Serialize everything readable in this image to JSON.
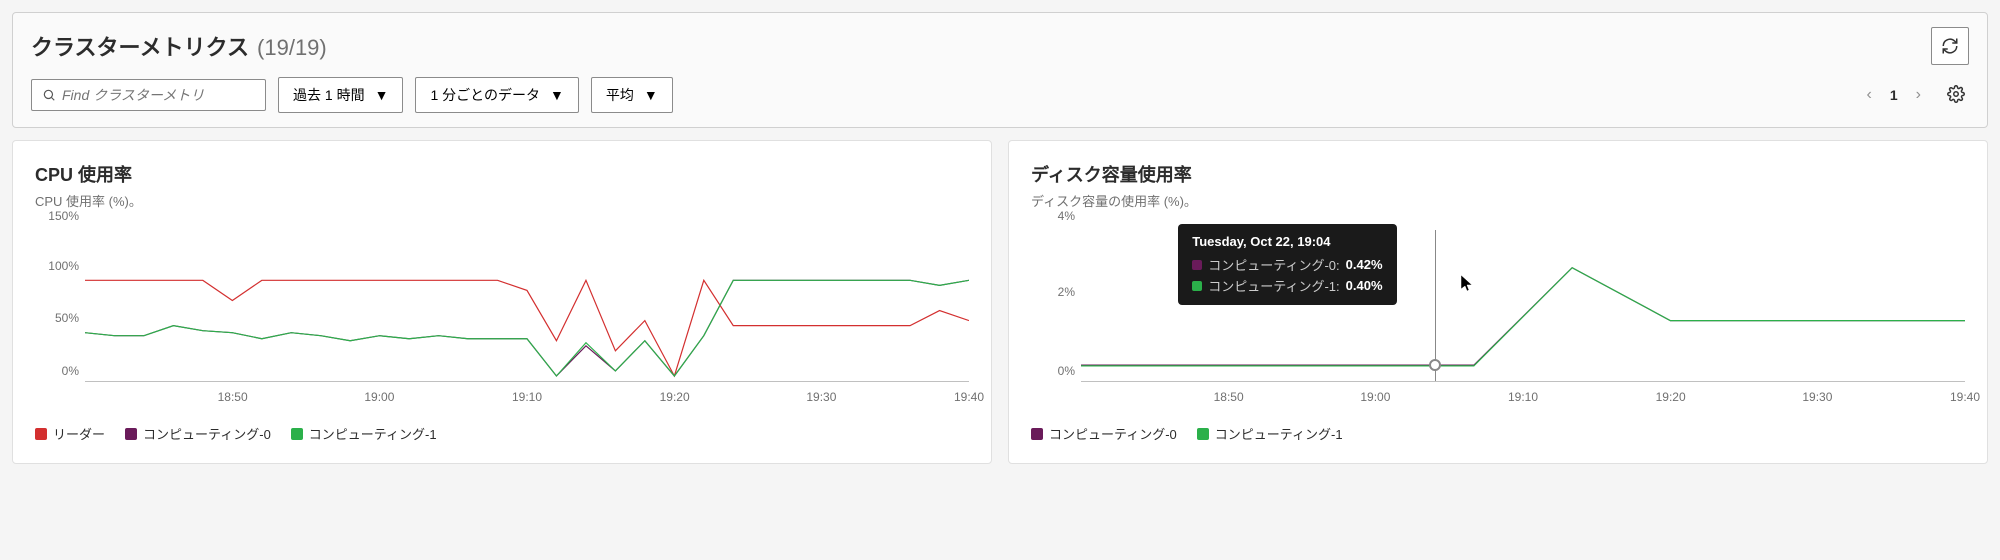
{
  "header": {
    "title": "クラスターメトリクス",
    "count": "(19/19)",
    "search_placeholder": "Find クラスターメトリ",
    "time_range": "過去 1 時間",
    "granularity": "1 分ごとのデータ",
    "aggregation": "平均",
    "page_num": "1"
  },
  "charts": {
    "cpu": {
      "title": "CPU 使用率",
      "subtitle": "CPU 使用率 (%)。",
      "y_ticks": [
        "0%",
        "50%",
        "100%",
        "150%"
      ],
      "x_ticks": [
        "18:50",
        "19:00",
        "19:10",
        "19:20",
        "19:30",
        "19:40"
      ],
      "legend": [
        {
          "label": "リーダー",
          "color": "#d32f2f"
        },
        {
          "label": "コンピューティング-0",
          "color": "#6a1b5a"
        },
        {
          "label": "コンピューティング-1",
          "color": "#2bb04a"
        }
      ]
    },
    "disk": {
      "title": "ディスク容量使用率",
      "subtitle": "ディスク容量の使用率 (%)。",
      "y_ticks": [
        "0%",
        "2%",
        "4%"
      ],
      "x_ticks": [
        "18:50",
        "19:00",
        "19:10",
        "19:20",
        "19:30",
        "19:40"
      ],
      "legend": [
        {
          "label": "コンピューティング-0",
          "color": "#6a1b5a"
        },
        {
          "label": "コンピューティング-1",
          "color": "#2bb04a"
        }
      ],
      "tooltip": {
        "title": "Tuesday, Oct 22, 19:04",
        "rows": [
          {
            "label": "コンピューティング-0:",
            "value": "0.42%",
            "color": "#6a1b5a"
          },
          {
            "label": "コンピューティング-1:",
            "value": "0.40%",
            "color": "#2bb04a"
          }
        ]
      }
    }
  },
  "chart_data": [
    {
      "type": "line",
      "title": "CPU 使用率",
      "ylabel": "CPU 使用率 (%)",
      "xlabel": "",
      "ylim": [
        0,
        150
      ],
      "x": [
        "18:40",
        "18:42",
        "18:44",
        "18:46",
        "18:48",
        "18:50",
        "18:52",
        "18:54",
        "18:56",
        "18:58",
        "19:00",
        "19:02",
        "19:04",
        "19:06",
        "19:08",
        "19:10",
        "19:12",
        "19:14",
        "19:16",
        "19:18",
        "19:20",
        "19:22",
        "19:24",
        "19:26",
        "19:28",
        "19:30",
        "19:32",
        "19:34",
        "19:36",
        "19:38",
        "19:40"
      ],
      "series": [
        {
          "name": "リーダー",
          "color": "#d32f2f",
          "values": [
            100,
            100,
            100,
            100,
            100,
            80,
            100,
            100,
            100,
            100,
            100,
            100,
            100,
            100,
            100,
            90,
            40,
            100,
            30,
            60,
            5,
            100,
            55,
            55,
            55,
            55,
            55,
            55,
            55,
            70,
            60
          ]
        },
        {
          "name": "コンピューティング-0",
          "color": "#6a1b5a",
          "values": [
            48,
            45,
            45,
            55,
            50,
            48,
            42,
            48,
            45,
            40,
            45,
            42,
            45,
            42,
            42,
            42,
            5,
            35,
            10,
            40,
            5,
            45,
            100,
            100,
            100,
            100,
            100,
            100,
            100,
            95,
            100
          ]
        },
        {
          "name": "コンピューティング-1",
          "color": "#2bb04a",
          "values": [
            48,
            45,
            45,
            55,
            50,
            48,
            42,
            48,
            45,
            40,
            45,
            42,
            45,
            42,
            42,
            42,
            5,
            38,
            10,
            40,
            5,
            45,
            100,
            100,
            100,
            100,
            100,
            100,
            100,
            95,
            100
          ]
        }
      ]
    },
    {
      "type": "line",
      "title": "ディスク容量使用率",
      "ylabel": "ディスク容量の使用率 (%)",
      "xlabel": "",
      "ylim": [
        0,
        4
      ],
      "x": [
        "18:40",
        "18:50",
        "19:00",
        "19:04",
        "19:08",
        "19:10",
        "19:12",
        "19:20",
        "19:30",
        "19:40"
      ],
      "series": [
        {
          "name": "コンピューティング-0",
          "color": "#6a1b5a",
          "values": [
            0.42,
            0.42,
            0.42,
            0.42,
            0.42,
            3.0,
            1.6,
            1.6,
            1.6,
            1.6
          ]
        },
        {
          "name": "コンピューティング-1",
          "color": "#2bb04a",
          "values": [
            0.4,
            0.4,
            0.4,
            0.4,
            0.4,
            3.0,
            1.6,
            1.6,
            1.6,
            1.6
          ]
        }
      ]
    }
  ]
}
